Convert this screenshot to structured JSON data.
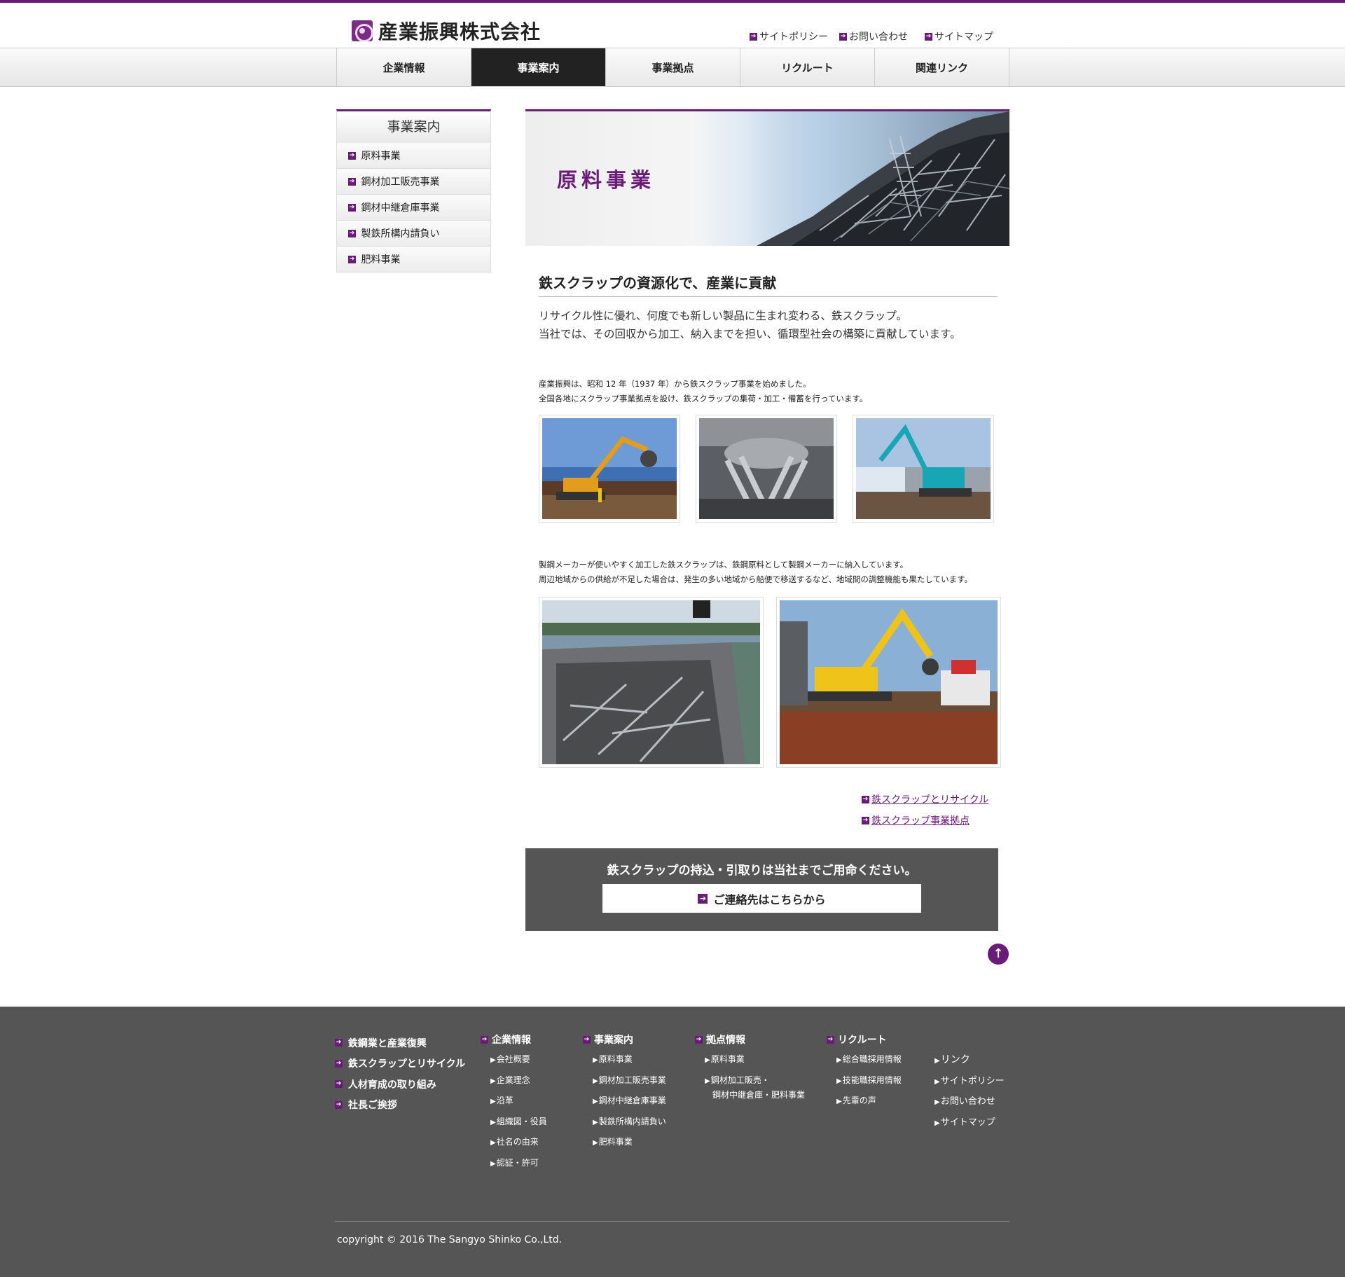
{
  "header": {
    "company_name": "産業振興株式会社",
    "util_nav": [
      "サイトポリシー",
      "お問い合わせ",
      "サイトマップ"
    ]
  },
  "gnav": [
    "企業情報",
    "事業案内",
    "事業拠点",
    "リクルート",
    "関連リンク"
  ],
  "sidebar": {
    "title": "事業案内",
    "items": [
      "原料事業",
      "鋼材加工販売事業",
      "鋼材中継倉庫事業",
      "製鉄所構内請負い",
      "肥料事業"
    ]
  },
  "main": {
    "hero_title": "原料事業",
    "heading": "鉄スクラップの資源化で、産業に貢献",
    "lead": [
      "リサイクル性に優れ、何度でも新しい製品に生まれ変わる、鉄スクラップ。",
      "当社では、その回収から加工、納入までを担い、循環型社会の構築に貢献しています。"
    ],
    "para1": [
      "産業振興は、昭和 12 年（1937 年）から鉄スクラップ事業を始めました。",
      "全国各地にスクラップ事業拠点を設け、鉄スクラップの集荷・加工・備蓄を行っています。"
    ],
    "para2": [
      "製鋼メーカーが使いやすく加工した鉄スクラップは、鉄鋼原料として製鋼メーカーに納入しています。",
      "周辺地域からの供給が不足した場合は、発生の多い地域から船便で移送するなど、地域間の調整機能も果たしています。"
    ],
    "links": [
      "鉄スクラップとリサイクル",
      "鉄スクラップ事業拠点"
    ],
    "cta": {
      "text": "鉄スクラップの持込・引取りは当社までご用命ください。",
      "button": "ご連絡先はこちらから"
    }
  },
  "footer": {
    "big_links": [
      "鉄鋼業と産業復興",
      "鉄スクラップとリサイクル",
      "人材育成の取り組み",
      "社長ご挨拶"
    ],
    "columns": [
      {
        "head": "企業情報",
        "items": [
          "会社概要",
          "企業理念",
          "沿革",
          "組織図・役員",
          "社名の由来",
          "認証・許可"
        ]
      },
      {
        "head": "事業案内",
        "items": [
          "原料事業",
          "鋼材加工販売事業",
          "鋼材中継倉庫事業",
          "製鉄所構内請負い",
          "肥料事業"
        ]
      },
      {
        "head": "拠点情報",
        "items": [
          "原料事業",
          "鋼材加工販売・",
          "鋼材中継倉庫・肥料事業"
        ]
      },
      {
        "head": "リクルート",
        "items": [
          "総合職採用情報",
          "技能職採用情報",
          "先輩の声"
        ]
      }
    ],
    "misc": [
      "リンク",
      "サイトポリシー",
      "お問い合わせ",
      "サイトマップ"
    ],
    "copyright": "copyright © 2016 The Sangyo Shinko Co.,Ltd."
  },
  "colors": {
    "accent": "#6a1a77",
    "footer_bg": "#555555",
    "active_nav": "#222222"
  }
}
